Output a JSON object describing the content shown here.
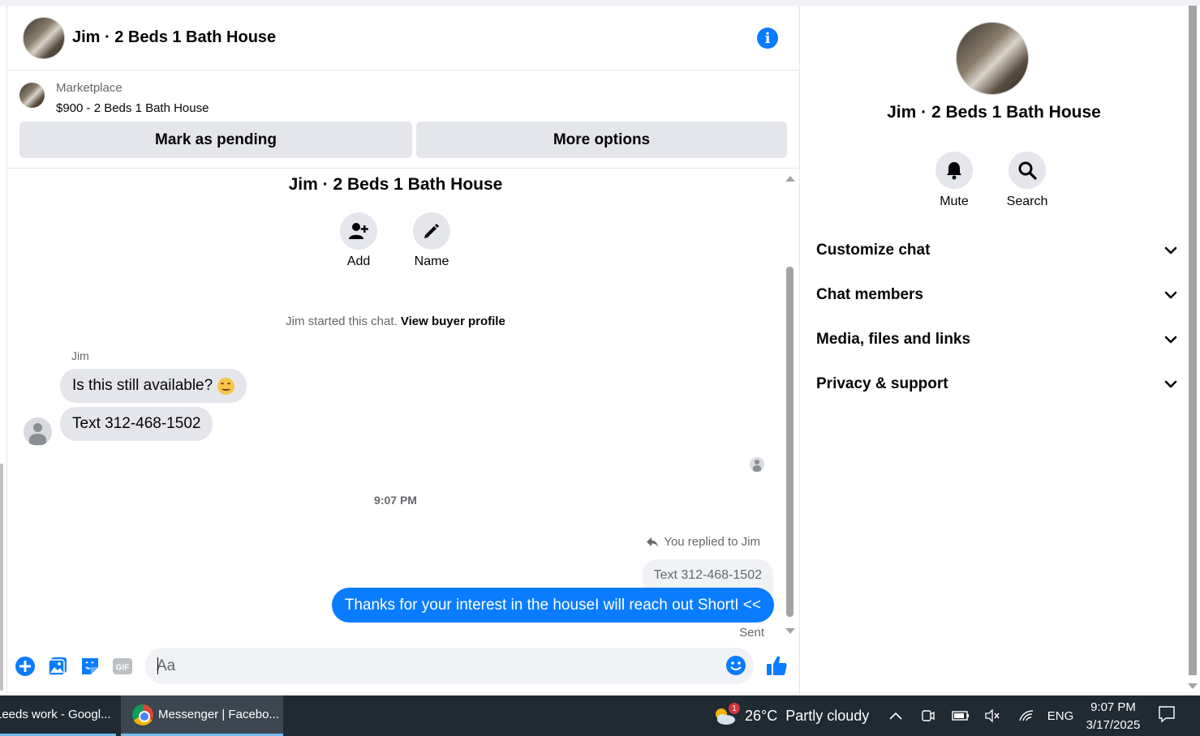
{
  "chat": {
    "title": "Jim · 2 Beds 1 Bath House",
    "info_icon": "i",
    "listing": {
      "label": "Marketplace",
      "price_title": "$900 - 2 Beds 1 Bath House",
      "mark_pending": "Mark as pending",
      "more_options": "More options"
    },
    "conversation_title": "Jim · 2 Beds 1 Bath House",
    "actions": [
      {
        "label": "Add",
        "icon": "add-person-icon"
      },
      {
        "label": "Name",
        "icon": "pencil-icon"
      }
    ],
    "started_text": "Jim started this chat.",
    "view_buyer_profile": "View buyer profile",
    "sender_name": "Jim",
    "incoming": [
      {
        "text": "Is this still available?"
      },
      {
        "text": "Text 312-468-1502"
      }
    ],
    "timestamp": "9:07 PM",
    "replied_to": "You replied to Jim",
    "quoted_text": "Text 312-468-1502",
    "outgoing_text": "Thanks for your interest in the houseI will reach out ShortI <<",
    "sent_status": "Sent",
    "composer": {
      "placeholder": "Aa"
    }
  },
  "panel": {
    "title": "Jim · 2 Beds 1 Bath House",
    "actions": [
      {
        "label": "Mute",
        "icon": "bell-icon"
      },
      {
        "label": "Search",
        "icon": "search-icon"
      }
    ],
    "sections": [
      "Customize chat",
      "Chat members",
      "Media, files and links",
      "Privacy & support"
    ]
  },
  "taskbar": {
    "item1": "Leeds work - Googl...",
    "item2": "Messenger | Facebo...",
    "weather_badge": "1",
    "weather": "26°C  Partly cloudy",
    "language": "ENG",
    "time": "9:07 PM",
    "date": "3/17/2025"
  },
  "colors": {
    "accent": "#0a7cff",
    "bubble_gray": "#e4e6eb",
    "taskbar": "#1f2a33"
  }
}
